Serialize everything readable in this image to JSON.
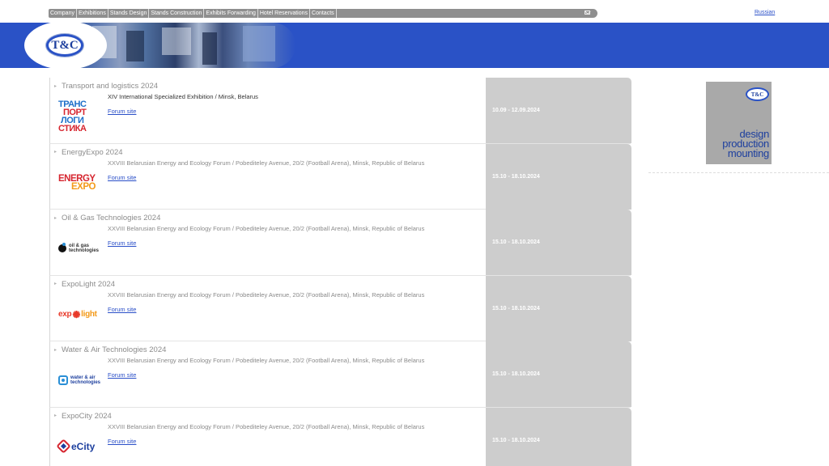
{
  "nav": {
    "items": [
      "Company",
      "Exhibitions",
      "Stands Design",
      "Stands Construction",
      "Exhibits Forwarding",
      "Hotel Reservations",
      "Contacts"
    ],
    "mail_icon": "mail-icon"
  },
  "lang_link": "Russian",
  "logo": {
    "text": "T&C"
  },
  "side_ad": {
    "badge": "T&C",
    "lines": [
      "design",
      "production",
      "mounting"
    ]
  },
  "events": [
    {
      "title": "Transport and logistics 2024",
      "desc": "XIV International Specialized Exhibition / Minsk, Belarus",
      "link": "Forum site",
      "date": "10.09 - 12.09.2024",
      "logo_lines": [
        "ТРАНС",
        "ПОРТ",
        "ЛОГИ",
        "СТИКА"
      ]
    },
    {
      "title": "EnergyExpo 2024",
      "desc": "XXVIII Belarusian Energy and Ecology Forum / Pobediteley Avenue, 20/2 (Football Arena), Minsk, Republic of Belarus",
      "link": "Forum site",
      "date": "15.10 - 18.10.2024",
      "logo_lines": [
        "ENERGY",
        "EXPO"
      ]
    },
    {
      "title": "Oil & Gas Technologies 2024",
      "desc": "XXVIII Belarusian Energy and Ecology Forum / Pobediteley Avenue, 20/2 (Football Arena), Minsk, Republic of Belarus",
      "link": "Forum site",
      "date": "15.10 - 18.10.2024",
      "logo_lines": [
        "oil & gas",
        "technologies"
      ]
    },
    {
      "title": "ExpoLight 2024",
      "desc": "XXVIII Belarusian Energy and Ecology Forum / Pobediteley Avenue, 20/2 (Football Arena), Minsk, Republic of Belarus",
      "link": "Forum site",
      "date": "15.10 - 18.10.2024",
      "logo_lines": [
        "exp",
        "light"
      ]
    },
    {
      "title": "Water & Air Technologies 2024",
      "desc": "XXVIII Belarusian Energy and Ecology Forum / Pobediteley Avenue, 20/2 (Football Arena), Minsk, Republic of Belarus",
      "link": "Forum site",
      "date": "15.10 - 18.10.2024",
      "logo_lines": [
        "water & air",
        "technologies"
      ]
    },
    {
      "title": "ExpoCity 2024",
      "desc": "XXVIII Belarusian Energy and Ecology Forum / Pobediteley Avenue, 20/2 (Football Arena), Minsk, Republic of Belarus",
      "link": "Forum site",
      "date": "15.10 - 18.10.2024",
      "logo_lines": [
        "eCity"
      ]
    }
  ]
}
